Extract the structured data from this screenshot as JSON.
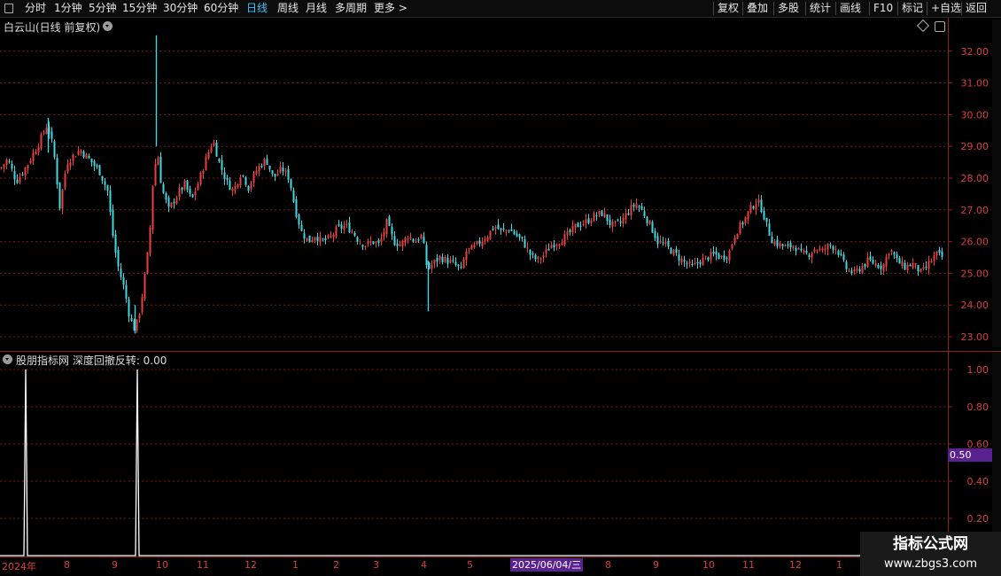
{
  "toolbar": {
    "periods": [
      {
        "label": "分时",
        "active": false
      },
      {
        "label": "1分钟",
        "active": false
      },
      {
        "label": "5分钟",
        "active": false
      },
      {
        "label": "15分钟",
        "active": false
      },
      {
        "label": "30分钟",
        "active": false
      },
      {
        "label": "60分钟",
        "active": false
      },
      {
        "label": "日线",
        "active": true
      },
      {
        "label": "周线",
        "active": false
      },
      {
        "label": "月线",
        "active": false
      },
      {
        "label": "多周期",
        "active": false
      },
      {
        "label": "更多",
        "active": false
      }
    ],
    "more_chevron": ">",
    "right_buttons": [
      "复权",
      "叠加",
      "多股",
      "统计",
      "画线",
      "F10",
      "标记",
      "+自选",
      "返回"
    ]
  },
  "main_chart": {
    "title": "白云山(日线 前复权)"
  },
  "indicator": {
    "title": "股朋指标网 深度回撤反转: 0.00",
    "badge_value": "0.50"
  },
  "colors": {
    "up": "#e8413f",
    "down": "#3fd7e0",
    "grid": "#7a1a1a",
    "axis_text": "#dc3c3c",
    "badge": "#5a2190"
  },
  "chart_data": [
    {
      "type": "candlestick",
      "ylim": [
        22.7,
        33.2
      ],
      "yticks": [
        23.0,
        24.0,
        25.0,
        26.0,
        27.0,
        28.0,
        29.0,
        30.0,
        31.0,
        32.0
      ],
      "ytick_labels": [
        "23.00",
        "24.00",
        "25.00",
        "26.00",
        "27.00",
        "28.00",
        "29.00",
        "30.00",
        "31.00",
        "32.00"
      ],
      "xtick_labels": [
        "2024年",
        "8",
        "9",
        "10",
        "11",
        "12",
        "1",
        "2",
        "3",
        "4",
        "5",
        "8",
        "9",
        "10",
        "11",
        "12",
        "1"
      ],
      "cursor_date": "2025/06/04/三",
      "close_path": [
        [
          0,
          28.3
        ],
        [
          8,
          28.6
        ],
        [
          18,
          27.9
        ],
        [
          30,
          28.4
        ],
        [
          45,
          29.2
        ],
        [
          53,
          29.7
        ],
        [
          60,
          28.9
        ],
        [
          67,
          27.1
        ],
        [
          75,
          28.5
        ],
        [
          90,
          28.9
        ],
        [
          100,
          28.6
        ],
        [
          112,
          28.2
        ],
        [
          121,
          27.6
        ],
        [
          127,
          26.2
        ],
        [
          132,
          25.3
        ],
        [
          140,
          24.5
        ],
        [
          146,
          23.6
        ],
        [
          152,
          23.2
        ],
        [
          158,
          23.9
        ],
        [
          163,
          24.9
        ],
        [
          168,
          26.0
        ],
        [
          172,
          27.8
        ],
        [
          177,
          28.9
        ],
        [
          182,
          27.7
        ],
        [
          190,
          27.0
        ],
        [
          200,
          27.5
        ],
        [
          208,
          27.8
        ],
        [
          216,
          27.3
        ],
        [
          224,
          27.9
        ],
        [
          232,
          28.6
        ],
        [
          240,
          29.2
        ],
        [
          247,
          28.5
        ],
        [
          255,
          27.9
        ],
        [
          263,
          27.6
        ],
        [
          272,
          28.2
        ],
        [
          280,
          27.7
        ],
        [
          290,
          28.3
        ],
        [
          300,
          28.6
        ],
        [
          308,
          28.0
        ],
        [
          318,
          28.3
        ],
        [
          326,
          28.0
        ],
        [
          333,
          27.0
        ],
        [
          340,
          26.3
        ],
        [
          348,
          26.0
        ],
        [
          355,
          26.2
        ],
        [
          363,
          26.0
        ],
        [
          372,
          26.1
        ],
        [
          380,
          26.4
        ],
        [
          390,
          26.5
        ],
        [
          398,
          26.3
        ],
        [
          405,
          26.0
        ],
        [
          412,
          25.9
        ],
        [
          420,
          26.0
        ],
        [
          428,
          25.9
        ],
        [
          436,
          26.6
        ],
        [
          444,
          26.0
        ],
        [
          452,
          25.9
        ],
        [
          460,
          26.2
        ],
        [
          468,
          26.0
        ],
        [
          476,
          26.2
        ],
        [
          482,
          25.1
        ],
        [
          488,
          25.3
        ],
        [
          496,
          25.5
        ],
        [
          504,
          25.4
        ],
        [
          512,
          25.3
        ],
        [
          520,
          25.1
        ],
        [
          526,
          25.7
        ],
        [
          534,
          25.8
        ],
        [
          542,
          26.0
        ],
        [
          550,
          26.2
        ],
        [
          558,
          26.5
        ],
        [
          566,
          26.3
        ],
        [
          574,
          26.4
        ],
        [
          582,
          26.2
        ],
        [
          590,
          26.0
        ],
        [
          598,
          25.6
        ],
        [
          606,
          25.4
        ],
        [
          614,
          25.6
        ],
        [
          622,
          25.9
        ],
        [
          630,
          26.0
        ],
        [
          640,
          26.2
        ],
        [
          650,
          26.5
        ],
        [
          660,
          26.6
        ],
        [
          670,
          26.8
        ],
        [
          680,
          26.9
        ],
        [
          690,
          26.5
        ],
        [
          700,
          26.6
        ],
        [
          710,
          27.0
        ],
        [
          718,
          27.2
        ],
        [
          726,
          26.9
        ],
        [
          734,
          26.5
        ],
        [
          742,
          26.0
        ],
        [
          750,
          25.9
        ],
        [
          758,
          25.7
        ],
        [
          766,
          25.5
        ],
        [
          774,
          25.3
        ],
        [
          782,
          25.2
        ],
        [
          790,
          25.4
        ],
        [
          798,
          25.5
        ],
        [
          806,
          25.6
        ],
        [
          814,
          25.5
        ],
        [
          822,
          25.6
        ],
        [
          830,
          26.3
        ],
        [
          838,
          26.6
        ],
        [
          846,
          27.0
        ],
        [
          854,
          27.3
        ],
        [
          860,
          27.0
        ],
        [
          866,
          26.4
        ],
        [
          872,
          26.0
        ],
        [
          880,
          25.9
        ],
        [
          888,
          25.8
        ],
        [
          896,
          25.9
        ],
        [
          904,
          25.6
        ],
        [
          912,
          25.6
        ],
        [
          920,
          25.8
        ],
        [
          928,
          25.7
        ],
        [
          936,
          25.9
        ],
        [
          944,
          25.8
        ],
        [
          950,
          25.4
        ],
        [
          956,
          25.1
        ],
        [
          964,
          25.0
        ],
        [
          972,
          25.2
        ],
        [
          980,
          25.4
        ],
        [
          988,
          25.3
        ],
        [
          996,
          25.2
        ],
        [
          1004,
          25.8
        ],
        [
          1012,
          25.4
        ],
        [
          1020,
          25.2
        ],
        [
          1030,
          25.3
        ],
        [
          1040,
          25.0
        ],
        [
          1048,
          25.3
        ],
        [
          1056,
          25.6
        ],
        [
          1064,
          25.5
        ]
      ]
    },
    {
      "type": "line",
      "name": "深度回撤反转",
      "ylim": [
        0,
        1.08
      ],
      "yticks": [
        0.2,
        0.4,
        0.6,
        0.8,
        1.0
      ],
      "ytick_labels": [
        "0.20",
        "0.40",
        "0.60",
        "0.80",
        "1.00"
      ],
      "signals_at_x": [
        29,
        155
      ]
    }
  ]
}
